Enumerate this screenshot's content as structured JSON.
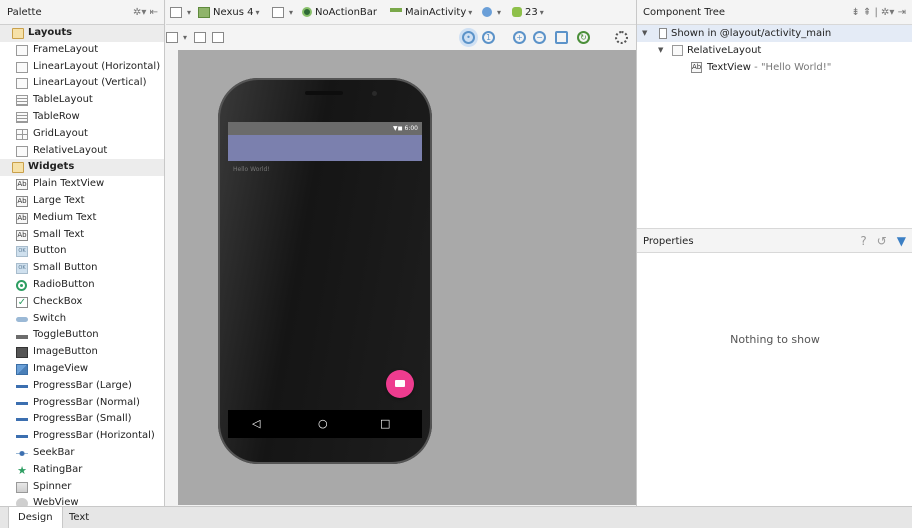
{
  "palette": {
    "title": "Palette",
    "items": [
      {
        "label": "Layouts",
        "icon": "folder-icon",
        "group": true
      },
      {
        "label": "FrameLayout",
        "icon": "frame-layout-icon"
      },
      {
        "label": "LinearLayout (Horizontal)",
        "icon": "linear-layout-horizontal-icon"
      },
      {
        "label": "LinearLayout (Vertical)",
        "icon": "linear-layout-vertical-icon"
      },
      {
        "label": "TableLayout",
        "icon": "table-layout-icon"
      },
      {
        "label": "TableRow",
        "icon": "table-row-icon"
      },
      {
        "label": "GridLayout",
        "icon": "grid-layout-icon"
      },
      {
        "label": "RelativeLayout",
        "icon": "relative-layout-icon"
      },
      {
        "label": "Widgets",
        "icon": "folder-icon",
        "group": true
      },
      {
        "label": "Plain TextView",
        "icon": "textview-icon"
      },
      {
        "label": "Large Text",
        "icon": "textview-icon"
      },
      {
        "label": "Medium Text",
        "icon": "textview-icon"
      },
      {
        "label": "Small Text",
        "icon": "textview-icon"
      },
      {
        "label": "Button",
        "icon": "button-icon"
      },
      {
        "label": "Small Button",
        "icon": "button-icon"
      },
      {
        "label": "RadioButton",
        "icon": "radio-button-icon"
      },
      {
        "label": "CheckBox",
        "icon": "checkbox-icon"
      },
      {
        "label": "Switch",
        "icon": "switch-icon"
      },
      {
        "label": "ToggleButton",
        "icon": "toggle-button-icon"
      },
      {
        "label": "ImageButton",
        "icon": "image-button-icon"
      },
      {
        "label": "ImageView",
        "icon": "image-view-icon"
      },
      {
        "label": "ProgressBar (Large)",
        "icon": "progress-bar-icon"
      },
      {
        "label": "ProgressBar (Normal)",
        "icon": "progress-bar-icon"
      },
      {
        "label": "ProgressBar (Small)",
        "icon": "progress-bar-icon"
      },
      {
        "label": "ProgressBar (Horizontal)",
        "icon": "progress-bar-icon"
      },
      {
        "label": "SeekBar",
        "icon": "seekbar-icon"
      },
      {
        "label": "RatingBar",
        "icon": "star-icon"
      },
      {
        "label": "Spinner",
        "icon": "spinner-icon"
      },
      {
        "label": "WebView",
        "icon": "webview-icon"
      }
    ]
  },
  "toolbar": {
    "device": "Nexus 4",
    "theme": "NoActionBar",
    "activity": "MainActivity",
    "api": "23"
  },
  "device_preview": {
    "status_time": "6:00",
    "hello_text": "Hello World!",
    "accent_color": "#EE3C8F",
    "appbar_color": "#7B80AE"
  },
  "component_tree": {
    "title": "Component Tree",
    "root": "Shown in @layout/activity_main",
    "layout": "RelativeLayout",
    "child_type": "TextView",
    "child_text": "- \"Hello World!\""
  },
  "properties": {
    "title": "Properties",
    "empty_message": "Nothing to show"
  },
  "tabs": {
    "design": "Design",
    "text": "Text"
  }
}
